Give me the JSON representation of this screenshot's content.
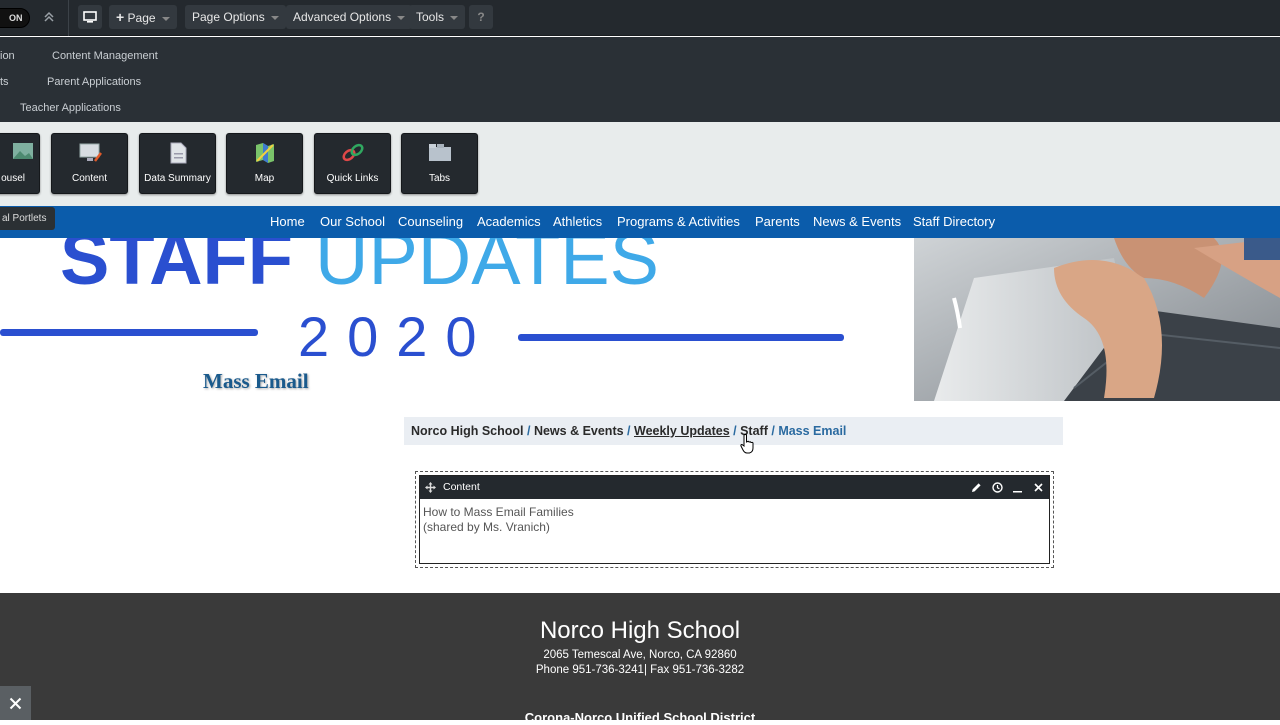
{
  "toolbar": {
    "toggle_label": "ON",
    "page_label": "Page",
    "page_options_label": "Page Options",
    "advanced_options_label": "Advanced Options",
    "tools_label": "Tools",
    "help_label": "?"
  },
  "submenu": {
    "items": [
      "ion",
      "Content Management",
      "ts",
      "Parent Applications",
      "Teacher Applications"
    ]
  },
  "widgets": [
    "ousel",
    "Content",
    "Data Summary",
    "Map",
    "Quick Links",
    "Tabs"
  ],
  "portlets_tab": "al Portlets",
  "nav": [
    "Home",
    "Our School",
    "Counseling",
    "Academics",
    "Athletics",
    "Programs & Activities",
    "Parents",
    "News & Events",
    "Staff Directory"
  ],
  "banner": {
    "word1": "STAFF",
    "word2": "UPDATES",
    "year": "2020"
  },
  "page_title": "Mass Email",
  "breadcrumb": {
    "items": [
      "Norco High School",
      "News & Events",
      "Weekly Updates",
      "Staff"
    ],
    "separator": "/",
    "current": "Mass Email"
  },
  "portlet": {
    "title": "Content",
    "line1": "How to Mass Email Families",
    "line2": "(shared by Ms. Vranich)"
  },
  "footer": {
    "school_name": "Norco High School",
    "address": "2065 Temescal Ave, Norco, CA 92860",
    "phone": "Phone 951-736-3241| Fax 951-736-3282",
    "district": "Corona-Norco Unified School District"
  },
  "colors": {
    "nav_blue": "#0b5cab",
    "banner_dark_blue": "#2a4fd0",
    "banner_light_blue": "#3fa9e8",
    "toolbar_dark": "#24292e",
    "footer_dark": "#3a3a3a"
  }
}
